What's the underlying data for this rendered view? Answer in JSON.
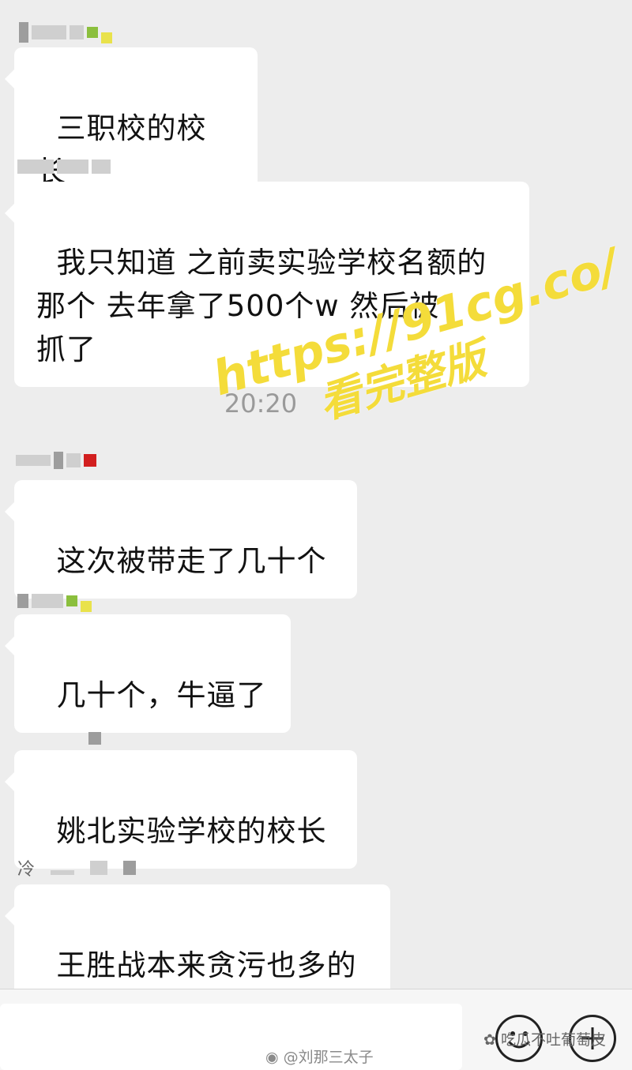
{
  "chat": {
    "messages": [
      {
        "text": "三职校的校长"
      },
      {
        "text": "我只知道 之前卖实验学校名额的\n那个 去年拿了500个w 然后被\n抓了"
      },
      {
        "text": "这次被带走了几十个"
      },
      {
        "text": "几十个，牛逼了"
      },
      {
        "text": "姚北实验学校的校长"
      },
      {
        "text": "王胜战本来贪污也多的"
      }
    ],
    "timestamp": "20:20",
    "sender_fragment": "冷"
  },
  "watermark": {
    "url": "https://91cg.co/",
    "subtitle": "看完整版",
    "color": "#f4dc3a"
  },
  "credits": {
    "weibo": "@刘那三太子",
    "wechat": "吃瓜不吐葡萄皮"
  },
  "icons": {
    "emoji": "smiley-face-icon",
    "more": "plus-circle-icon"
  },
  "colors": {
    "background": "#ededed",
    "bubble": "#ffffff",
    "watermark": "#f4dc3a"
  }
}
